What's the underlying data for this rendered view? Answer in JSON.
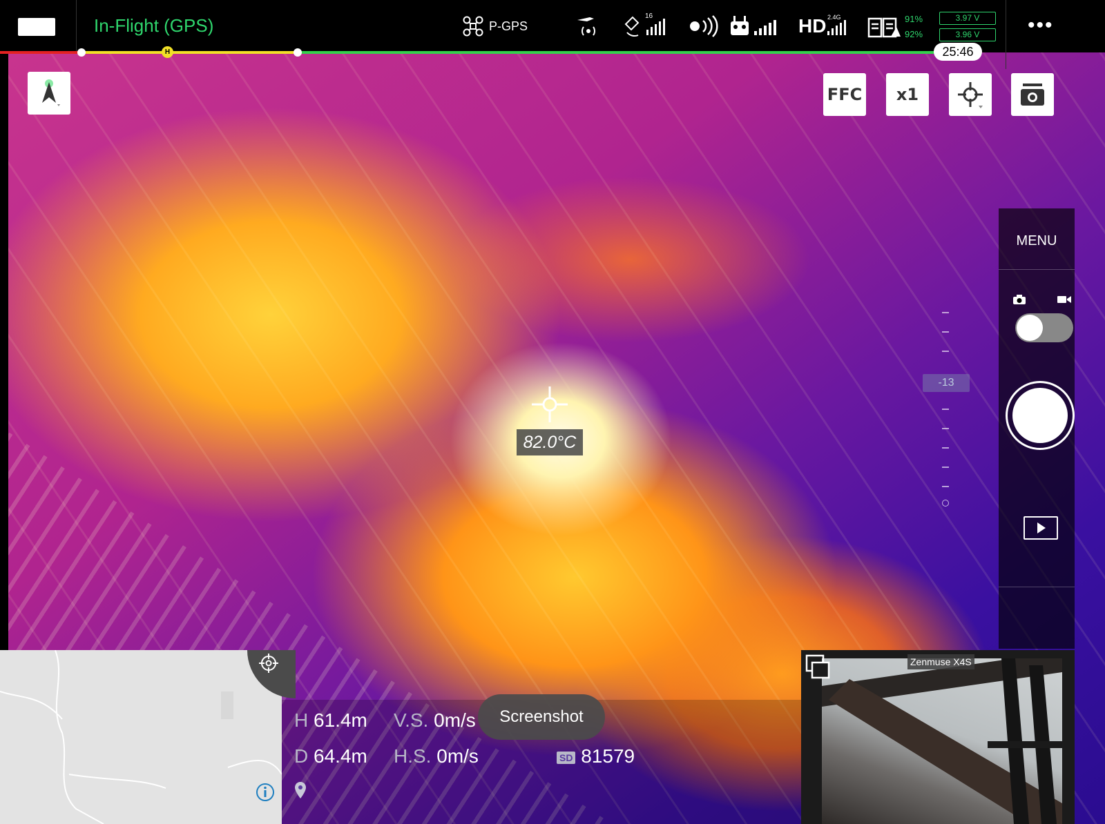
{
  "topbar": {
    "flight_status": "In-Flight (GPS)",
    "flight_mode": "P-GPS",
    "satellite_count": "16",
    "hd_band": "2.4G",
    "hd_label": "HD",
    "battery_1_pct": "91%",
    "battery_2_pct": "92%",
    "voltage_1": "3.97 V",
    "voltage_2": "3.96 V",
    "flight_time": "25:46",
    "home_marker": "H"
  },
  "camera_controls": {
    "ffc_label": "FFC",
    "zoom_label": "x1"
  },
  "right_panel": {
    "menu_label": "MENU",
    "capture_mode": "photo"
  },
  "exposure": {
    "ev_value": "-13"
  },
  "spot_meter": {
    "temperature": "82.0°C"
  },
  "telemetry": {
    "h_label": "H",
    "h_value": "61.4m",
    "d_label": "D",
    "d_value": "64.4m",
    "vs_label": "V.S.",
    "vs_value": "0m/s",
    "hs_label": "H.S.",
    "hs_value": "0m/s",
    "sd_label": "SD",
    "sd_remaining": "81579"
  },
  "toast": {
    "message": "Screenshot"
  },
  "pip": {
    "camera_name": "Zenmuse X4S"
  },
  "colors": {
    "status_green": "#2fd66d",
    "progress_red": "#e52222",
    "progress_yellow": "#f2e127",
    "progress_green": "#33d24c"
  },
  "icons": [
    "home-icon",
    "aircraft-icon",
    "signal-icon",
    "satellite-icon",
    "obstacle-sensing-icon",
    "remote-controller-icon",
    "hd-signal-icon",
    "battery-icon",
    "more-icon",
    "compass-icon",
    "focus-mode-icon",
    "camera-settings-icon",
    "photo-mode-icon",
    "video-mode-icon",
    "playback-icon",
    "recenter-map-icon",
    "info-icon",
    "location-pin-icon",
    "swap-view-icon",
    "crosshair-icon"
  ]
}
